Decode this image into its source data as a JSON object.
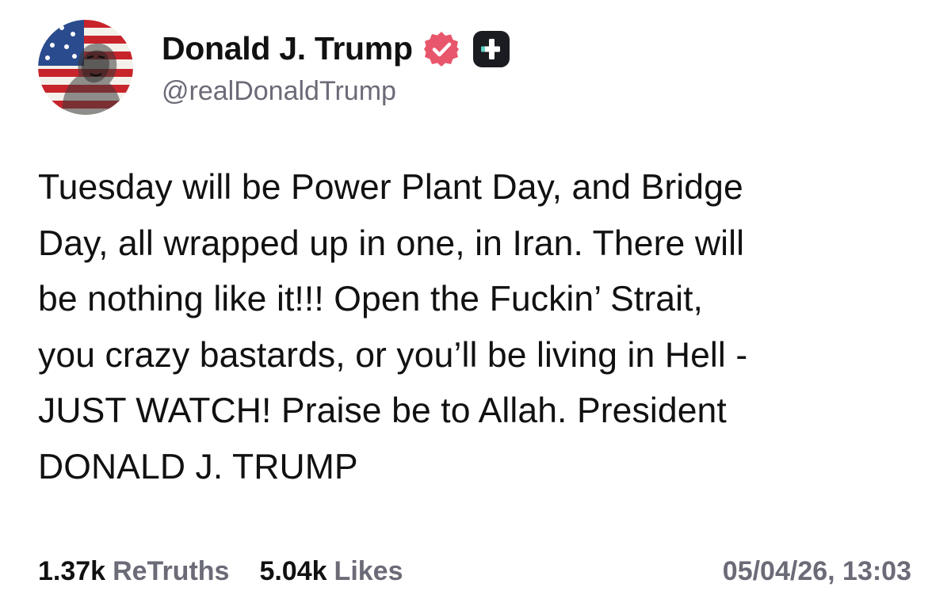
{
  "author": {
    "display_name": "Donald J. Trump",
    "handle": "@realDonaldTrump",
    "verified_badge_icon": "verified-check-icon",
    "verified_badge_color": "#e8566b",
    "plus_badge_icon": "truth-plus-icon"
  },
  "post": {
    "text": "Tuesday will be Power Plant Day, and Bridge\nDay, all wrapped up in one, in Iran. There will\nbe nothing like it!!! Open the Fuckin’ Strait,\nyou crazy bastards, or you’ll be living in Hell -\nJUST WATCH! Praise be to Allah. President\nDONALD J. TRUMP"
  },
  "stats": {
    "retruths_count": "1.37k",
    "retruths_label": "ReTruths",
    "likes_count": "5.04k",
    "likes_label": "Likes"
  },
  "timestamp": "05/04/26, 13:03",
  "colors": {
    "text_primary": "#111111",
    "text_secondary": "#6b6b78",
    "background": "#ffffff"
  }
}
